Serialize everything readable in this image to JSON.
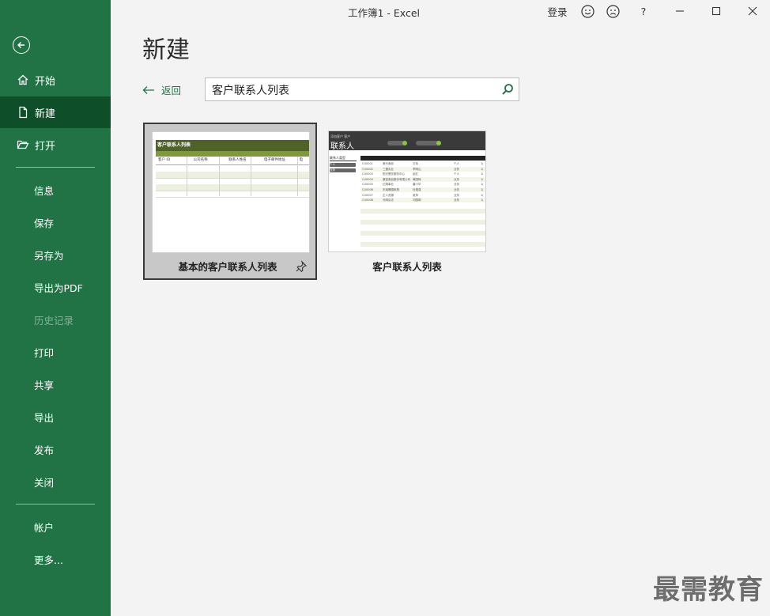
{
  "window": {
    "title": "工作簿1  -  Excel",
    "signin_label": "登录",
    "smile_icon": "smile-icon",
    "frown_icon": "frown-icon",
    "help_label": "?",
    "minimize_icon": "minimize-icon",
    "maximize_icon": "maximize-icon",
    "close_icon": "close-icon"
  },
  "sidebar": {
    "bg_color": "#217346",
    "active_color": "#0e4f2a",
    "back_icon": "back-arrow-icon",
    "top_items": [
      {
        "label": "开始",
        "icon": "home-icon"
      },
      {
        "label": "新建",
        "icon": "new-document-icon",
        "active": true
      },
      {
        "label": "打开",
        "icon": "open-folder-icon"
      }
    ],
    "mid_items": [
      {
        "label": "信息"
      },
      {
        "label": "保存"
      },
      {
        "label": "另存为"
      },
      {
        "label": "导出为PDF"
      },
      {
        "label": "历史记录",
        "disabled": true
      },
      {
        "label": "打印"
      },
      {
        "label": "共享"
      },
      {
        "label": "导出"
      },
      {
        "label": "发布"
      },
      {
        "label": "关闭"
      }
    ],
    "bottom_items": [
      {
        "label": "帐户"
      },
      {
        "label": "更多..."
      }
    ]
  },
  "main": {
    "title": "新建",
    "back_label": "返回",
    "search": {
      "value": "客户联系人列表",
      "icon": "search-icon"
    },
    "templates": [
      {
        "label": "基本的客户联系人列表",
        "selected": true,
        "pinned_icon": "pin-icon",
        "preview": {
          "header": "客户联系人列表",
          "columns": [
            "客户 ID",
            "公司名称",
            "联系人姓名",
            "电子邮件地址",
            "电"
          ]
        }
      },
      {
        "label": "客户联系人列表",
        "selected": false,
        "preview": {
          "small_text": "添加客户 客户",
          "header": "联系人",
          "filter_header": "联系人类型",
          "filter_items": [
            "个人",
            "业务"
          ],
          "columns": [
            "客户 ID",
            "公司",
            "联系人",
            "联系人类型",
            "电"
          ],
          "rows": [
            [
              "CU0001",
              "美代食品",
              "王伟",
              "个人",
              "1("
            ],
            [
              "CU0002",
              "三捷实业",
              "李明山",
              "业务",
              "1("
            ],
            [
              "CU0003",
              "阳光餐饮服务中心",
              "赵红",
              "个人",
              "1("
            ],
            [
              "CU0004",
              "康富食品股份有限公司",
              "黄国辉",
              "业务",
              "1("
            ],
            [
              "CU0005",
              "亿翔事业",
              "唐小华",
              "业务",
              "1("
            ],
            [
              "CU0006",
              "东南螺帽家具",
              "杜德强",
              "业务",
              "1("
            ],
            [
              "CU0007",
              "正人资源",
              "吴萍",
              "业务",
              "1("
            ],
            [
              "CU0008",
              "光明杂志",
              "刘国明",
              "业务",
              "1("
            ]
          ]
        }
      }
    ]
  },
  "watermark": "最需教育"
}
